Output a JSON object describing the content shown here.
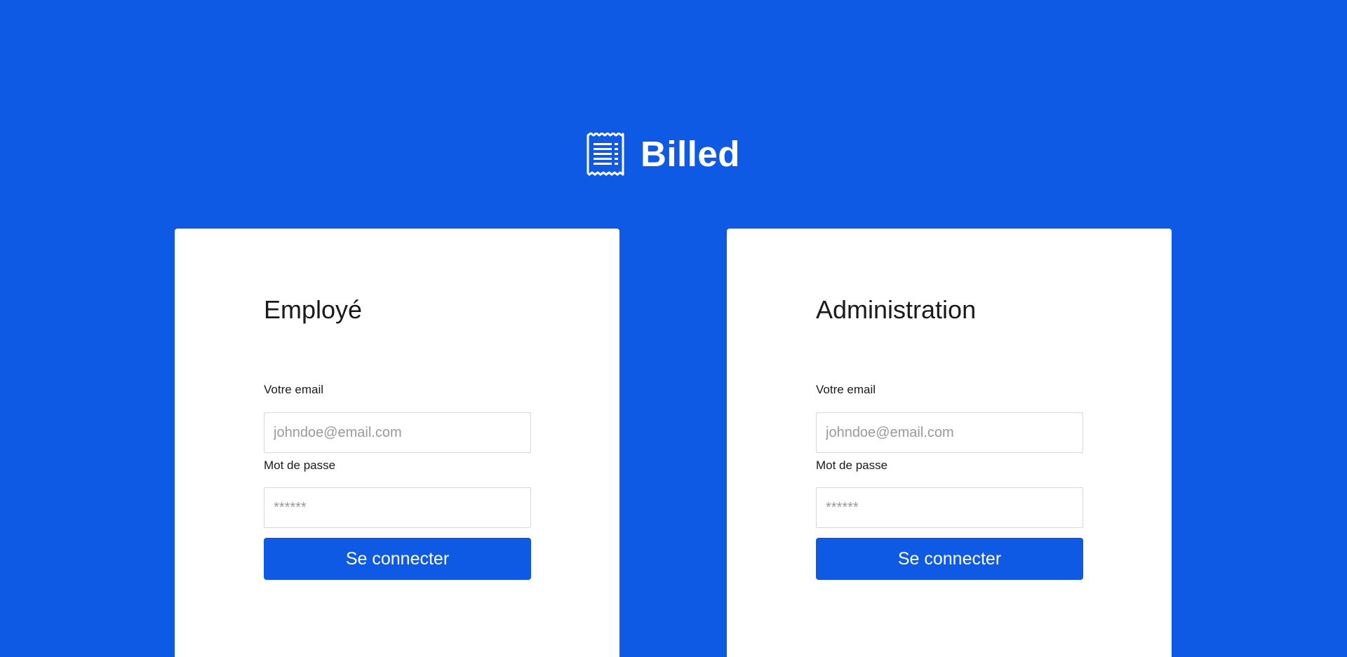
{
  "colors": {
    "background": "#0e5ae5",
    "card": "#ffffff",
    "button": "#0e5ae5",
    "button_text": "#ffffff",
    "text": "#1a1a1a"
  },
  "brand": {
    "icon": "receipt-icon",
    "title": "Billed"
  },
  "employee_form": {
    "title": "Employé",
    "email_label": "Votre email",
    "email_placeholder": "johndoe@email.com",
    "email_value": "",
    "password_label": "Mot de passe",
    "password_placeholder": "******",
    "password_value": "",
    "submit_label": "Se connecter"
  },
  "admin_form": {
    "title": "Administration",
    "email_label": "Votre email",
    "email_placeholder": "johndoe@email.com",
    "email_value": "",
    "password_label": "Mot de passe",
    "password_placeholder": "******",
    "password_value": "",
    "submit_label": "Se connecter"
  }
}
